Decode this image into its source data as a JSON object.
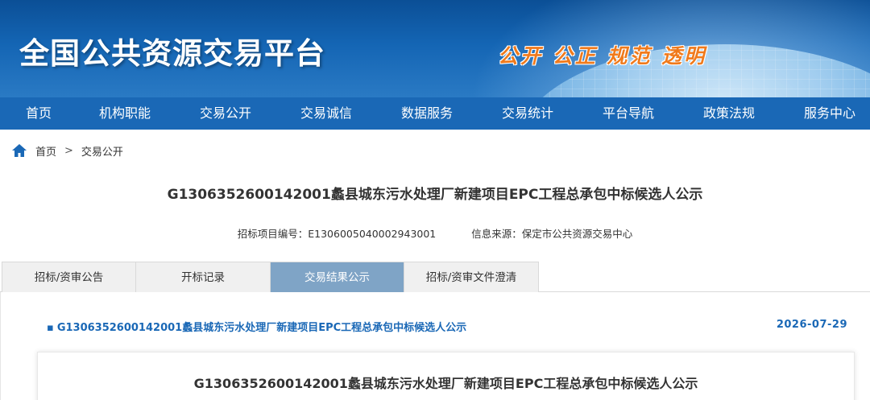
{
  "header": {
    "site_title": "全国公共资源交易平台",
    "slogan": "公开 公正 规范 透明"
  },
  "nav": {
    "items": [
      {
        "label": "首页"
      },
      {
        "label": "机构职能"
      },
      {
        "label": "交易公开"
      },
      {
        "label": "交易诚信"
      },
      {
        "label": "数据服务"
      },
      {
        "label": "交易统计"
      },
      {
        "label": "平台导航"
      },
      {
        "label": "政策法规"
      },
      {
        "label": "服务中心"
      }
    ]
  },
  "breadcrumb": {
    "icon": "home-icon",
    "home": "首页",
    "separator": ">",
    "current": "交易公开"
  },
  "page": {
    "title": "G1306352600142001蠡县城东污水处理厂新建项目EPC工程总承包中标候选人公示",
    "project_code_label": "招标项目编号：",
    "project_code": "E1306005040002943001",
    "source_label": "信息来源：",
    "source": "保定市公共资源交易中心"
  },
  "tabs": [
    {
      "label": "招标/资审公告",
      "active": false
    },
    {
      "label": "开标记录",
      "active": false
    },
    {
      "label": "交易结果公示",
      "active": true
    },
    {
      "label": "招标/资审文件澄清",
      "active": false
    }
  ],
  "notice": {
    "bullet": "▪",
    "link_text": "G1306352600142001蠡县城东污水处理厂新建项目EPC工程总承包中标候选人公示",
    "date": "2026-07-29"
  },
  "document": {
    "title": "G1306352600142001蠡县城东污水处理厂新建项目EPC工程总承包中标候选人公示"
  },
  "colors": {
    "nav_bg": "#1a68b6",
    "link": "#1a68b6",
    "active_tab": "#7fa4c6",
    "slogan": "#f07a1c"
  }
}
